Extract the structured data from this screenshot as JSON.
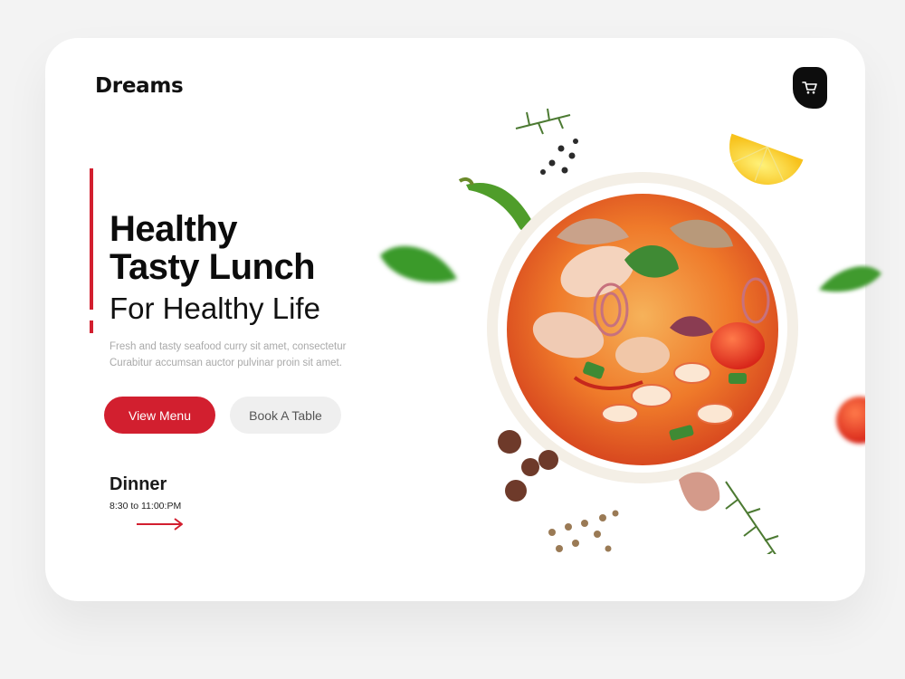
{
  "brand": {
    "name": "Dreams"
  },
  "header": {
    "cart_icon": "shopping-cart-icon"
  },
  "hero": {
    "headline_line1": "Healthy",
    "headline_line2": "Tasty Lunch",
    "subheadline": "For Healthy Life",
    "description_line1": "Fresh and tasty seafood curry sit amet, consectetur",
    "description_line2": "Curabitur accumsan auctor pulvinar proin sit amet."
  },
  "actions": {
    "primary_label": "View Menu",
    "secondary_label": "Book A Table"
  },
  "schedule": {
    "title": "Dinner",
    "hours": "8:30 to 11:00:PM",
    "arrow_icon": "arrow-right-icon"
  },
  "colors": {
    "accent": "#d21f2f",
    "background": "#f3f3f3",
    "card": "#ffffff",
    "dark": "#0d0d0d"
  }
}
